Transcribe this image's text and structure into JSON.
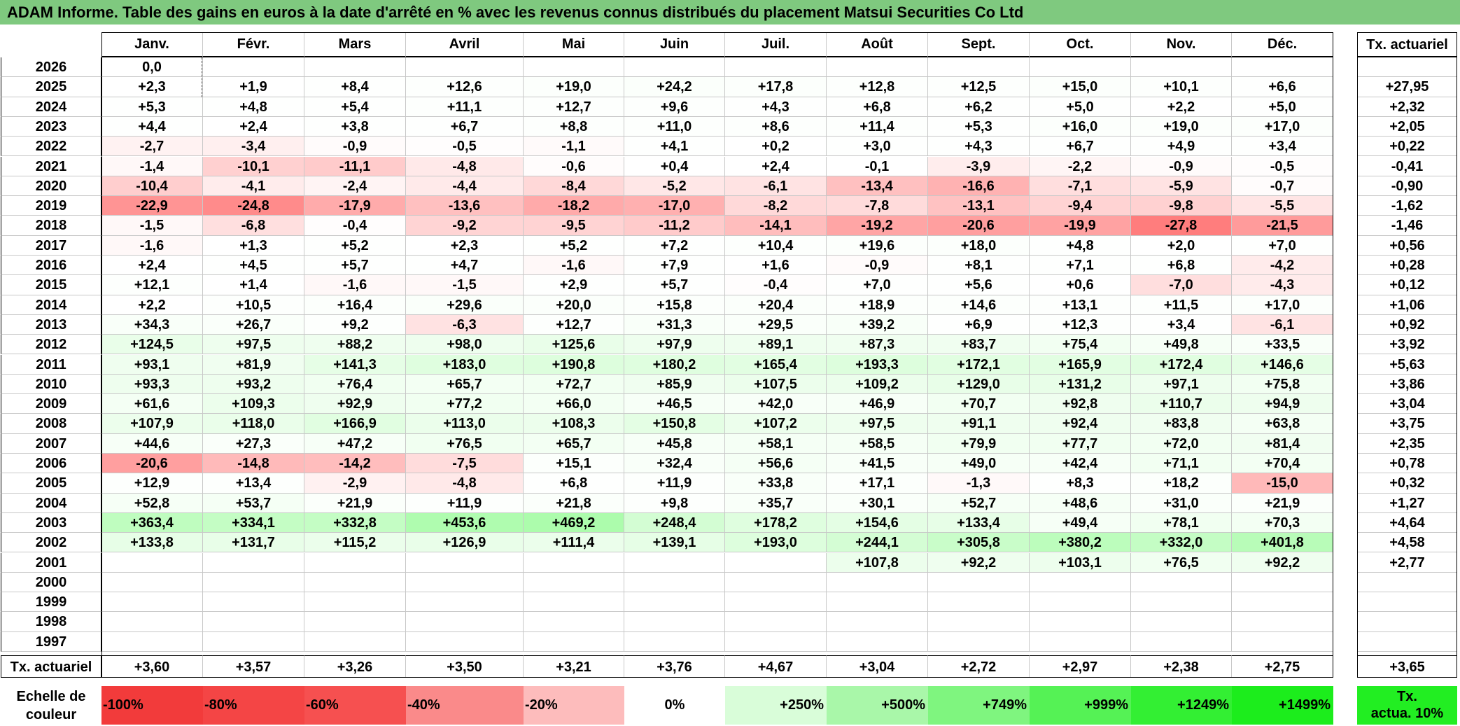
{
  "title": "ADAM Informe. Table des gains en euros à la date d'arrêté en % avec les revenus connus distribués du placement Matsui Securities Co Ltd",
  "months": [
    "Janv.",
    "Févr.",
    "Mars",
    "Avril",
    "Mai",
    "Juin",
    "Juil.",
    "Août",
    "Sept.",
    "Oct.",
    "Nov.",
    "Déc."
  ],
  "tx_header": "Tx. actuariel",
  "rows": [
    {
      "year": "2026",
      "values": [
        "0,0",
        "",
        "",
        "",
        "",
        "",
        "",
        "",
        "",
        "",
        "",
        ""
      ],
      "tx": ""
    },
    {
      "year": "2025",
      "values": [
        "+2,3",
        "+1,9",
        "+8,4",
        "+12,6",
        "+19,0",
        "+24,2",
        "+17,8",
        "+12,8",
        "+12,5",
        "+15,0",
        "+10,1",
        "+6,6"
      ],
      "tx": "+27,95"
    },
    {
      "year": "2024",
      "values": [
        "+5,3",
        "+4,8",
        "+5,4",
        "+11,1",
        "+12,7",
        "+9,6",
        "+4,3",
        "+6,8",
        "+6,2",
        "+5,0",
        "+2,2",
        "+5,0"
      ],
      "tx": "+2,32"
    },
    {
      "year": "2023",
      "values": [
        "+4,4",
        "+2,4",
        "+3,8",
        "+6,7",
        "+8,8",
        "+11,0",
        "+8,6",
        "+11,4",
        "+5,3",
        "+16,0",
        "+19,0",
        "+17,0"
      ],
      "tx": "+2,05"
    },
    {
      "year": "2022",
      "values": [
        "-2,7",
        "-3,4",
        "-0,9",
        "-0,5",
        "-1,1",
        "+4,1",
        "+0,2",
        "+3,0",
        "+4,3",
        "+6,7",
        "+4,9",
        "+3,4"
      ],
      "tx": "+0,22"
    },
    {
      "year": "2021",
      "values": [
        "-1,4",
        "-10,1",
        "-11,1",
        "-4,8",
        "-0,6",
        "+0,4",
        "+2,4",
        "-0,1",
        "-3,9",
        "-2,2",
        "-0,9",
        "-0,5"
      ],
      "tx": "-0,41"
    },
    {
      "year": "2020",
      "values": [
        "-10,4",
        "-4,1",
        "-2,4",
        "-4,4",
        "-8,4",
        "-5,2",
        "-6,1",
        "-13,4",
        "-16,6",
        "-7,1",
        "-5,9",
        "-0,7"
      ],
      "tx": "-0,90"
    },
    {
      "year": "2019",
      "values": [
        "-22,9",
        "-24,8",
        "-17,9",
        "-13,6",
        "-18,2",
        "-17,0",
        "-8,2",
        "-7,8",
        "-13,1",
        "-9,4",
        "-9,8",
        "-5,5"
      ],
      "tx": "-1,62"
    },
    {
      "year": "2018",
      "values": [
        "-1,5",
        "-6,8",
        "-0,4",
        "-9,2",
        "-9,5",
        "-11,2",
        "-14,1",
        "-19,2",
        "-20,6",
        "-19,9",
        "-27,8",
        "-21,5"
      ],
      "tx": "-1,46"
    },
    {
      "year": "2017",
      "values": [
        "-1,6",
        "+1,3",
        "+5,2",
        "+2,3",
        "+5,2",
        "+7,2",
        "+10,4",
        "+19,6",
        "+18,0",
        "+4,8",
        "+2,0",
        "+7,0"
      ],
      "tx": "+0,56"
    },
    {
      "year": "2016",
      "values": [
        "+2,4",
        "+4,5",
        "+5,7",
        "+4,7",
        "-1,6",
        "+7,9",
        "+1,6",
        "-0,9",
        "+8,1",
        "+7,1",
        "+6,8",
        "-4,2"
      ],
      "tx": "+0,28"
    },
    {
      "year": "2015",
      "values": [
        "+12,1",
        "+1,4",
        "-1,6",
        "-1,5",
        "+2,9",
        "+5,7",
        "-0,4",
        "+7,0",
        "+5,6",
        "+0,6",
        "-7,0",
        "-4,3"
      ],
      "tx": "+0,12"
    },
    {
      "year": "2014",
      "values": [
        "+2,2",
        "+10,5",
        "+16,4",
        "+29,6",
        "+20,0",
        "+15,8",
        "+20,4",
        "+18,9",
        "+14,6",
        "+13,1",
        "+11,5",
        "+17,0"
      ],
      "tx": "+1,06"
    },
    {
      "year": "2013",
      "values": [
        "+34,3",
        "+26,7",
        "+9,2",
        "-6,3",
        "+12,7",
        "+31,3",
        "+29,5",
        "+39,2",
        "+6,9",
        "+12,3",
        "+3,4",
        "-6,1"
      ],
      "tx": "+0,92"
    },
    {
      "year": "2012",
      "values": [
        "+124,5",
        "+97,5",
        "+88,2",
        "+98,0",
        "+125,6",
        "+97,9",
        "+89,1",
        "+87,3",
        "+83,7",
        "+75,4",
        "+49,8",
        "+33,5"
      ],
      "tx": "+3,92"
    },
    {
      "year": "2011",
      "values": [
        "+93,1",
        "+81,9",
        "+141,3",
        "+183,0",
        "+190,8",
        "+180,2",
        "+165,4",
        "+193,3",
        "+172,1",
        "+165,9",
        "+172,4",
        "+146,6"
      ],
      "tx": "+5,63"
    },
    {
      "year": "2010",
      "values": [
        "+93,3",
        "+93,2",
        "+76,4",
        "+65,7",
        "+72,7",
        "+85,9",
        "+107,5",
        "+109,2",
        "+129,0",
        "+131,2",
        "+97,1",
        "+75,8"
      ],
      "tx": "+3,86"
    },
    {
      "year": "2009",
      "values": [
        "+61,6",
        "+109,3",
        "+92,9",
        "+77,2",
        "+66,0",
        "+46,5",
        "+42,0",
        "+46,9",
        "+70,7",
        "+92,8",
        "+110,7",
        "+94,9"
      ],
      "tx": "+3,04"
    },
    {
      "year": "2008",
      "values": [
        "+107,9",
        "+118,0",
        "+166,9",
        "+113,0",
        "+108,3",
        "+150,8",
        "+107,2",
        "+97,5",
        "+91,1",
        "+92,4",
        "+83,8",
        "+63,8"
      ],
      "tx": "+3,75"
    },
    {
      "year": "2007",
      "values": [
        "+44,6",
        "+27,3",
        "+47,2",
        "+76,5",
        "+65,7",
        "+45,8",
        "+58,1",
        "+58,5",
        "+79,9",
        "+77,7",
        "+72,0",
        "+81,4"
      ],
      "tx": "+2,35"
    },
    {
      "year": "2006",
      "values": [
        "-20,6",
        "-14,8",
        "-14,2",
        "-7,5",
        "+15,1",
        "+32,4",
        "+56,6",
        "+41,5",
        "+49,0",
        "+42,4",
        "+71,1",
        "+70,4"
      ],
      "tx": "+0,78"
    },
    {
      "year": "2005",
      "values": [
        "+12,9",
        "+13,4",
        "-2,9",
        "-4,8",
        "+6,8",
        "+11,9",
        "+33,8",
        "+17,1",
        "-1,3",
        "+8,3",
        "+18,2",
        "-15,0"
      ],
      "tx": "+0,32"
    },
    {
      "year": "2004",
      "values": [
        "+52,8",
        "+53,7",
        "+21,9",
        "+11,9",
        "+21,8",
        "+9,8",
        "+35,7",
        "+30,1",
        "+52,7",
        "+48,6",
        "+31,0",
        "+21,9"
      ],
      "tx": "+1,27"
    },
    {
      "year": "2003",
      "values": [
        "+363,4",
        "+334,1",
        "+332,8",
        "+453,6",
        "+469,2",
        "+248,4",
        "+178,2",
        "+154,6",
        "+133,4",
        "+49,4",
        "+78,1",
        "+70,3"
      ],
      "tx": "+4,64"
    },
    {
      "year": "2002",
      "values": [
        "+133,8",
        "+131,7",
        "+115,2",
        "+126,9",
        "+111,4",
        "+139,1",
        "+193,0",
        "+244,1",
        "+305,8",
        "+380,2",
        "+332,0",
        "+401,8"
      ],
      "tx": "+4,58"
    },
    {
      "year": "2001",
      "values": [
        "",
        "",
        "",
        "",
        "",
        "",
        "",
        "+107,8",
        "+92,2",
        "+103,1",
        "+76,5",
        "+92,2"
      ],
      "tx": "+2,77"
    },
    {
      "year": "2000",
      "values": [
        "",
        "",
        "",
        "",
        "",
        "",
        "",
        "",
        "",
        "",
        "",
        ""
      ],
      "tx": ""
    },
    {
      "year": "1999",
      "values": [
        "",
        "",
        "",
        "",
        "",
        "",
        "",
        "",
        "",
        "",
        "",
        ""
      ],
      "tx": ""
    },
    {
      "year": "1998",
      "values": [
        "",
        "",
        "",
        "",
        "",
        "",
        "",
        "",
        "",
        "",
        "",
        ""
      ],
      "tx": ""
    },
    {
      "year": "1997",
      "values": [
        "",
        "",
        "",
        "",
        "",
        "",
        "",
        "",
        "",
        "",
        "",
        ""
      ],
      "tx": ""
    }
  ],
  "footer": {
    "label": "Tx. actuariel",
    "values": [
      "+3,60",
      "+3,57",
      "+3,26",
      "+3,50",
      "+3,21",
      "+3,76",
      "+4,67",
      "+3,04",
      "+2,72",
      "+2,97",
      "+2,38",
      "+2,75"
    ],
    "tx": "+3,65"
  },
  "scale": {
    "label_line1": "Echelle de",
    "label_line2": "couleur",
    "items": [
      {
        "text": "-100%",
        "color": "#f23b3b",
        "align": "left"
      },
      {
        "text": "-80%",
        "color": "#f44545",
        "align": "left"
      },
      {
        "text": "-60%",
        "color": "#f65050",
        "align": "left"
      },
      {
        "text": "-40%",
        "color": "#fa8a8a",
        "align": "left"
      },
      {
        "text": "-20%",
        "color": "#fdbcbc",
        "align": "left"
      },
      {
        "text": "0%",
        "color": "#ffffff",
        "align": "center"
      },
      {
        "text": "+250%",
        "color": "#d9fdd9",
        "align": "right"
      },
      {
        "text": "+500%",
        "color": "#a9f7a9",
        "align": "right"
      },
      {
        "text": "+749%",
        "color": "#7ff57f",
        "align": "right"
      },
      {
        "text": "+999%",
        "color": "#55f255",
        "align": "right"
      },
      {
        "text": "+1249%",
        "color": "#33ef33",
        "align": "right"
      },
      {
        "text": "+1499%",
        "color": "#1ced1c",
        "align": "right"
      }
    ],
    "tx_line1": "Tx.",
    "tx_line2": "actua. 10%",
    "tx_color": "#22ee22"
  }
}
